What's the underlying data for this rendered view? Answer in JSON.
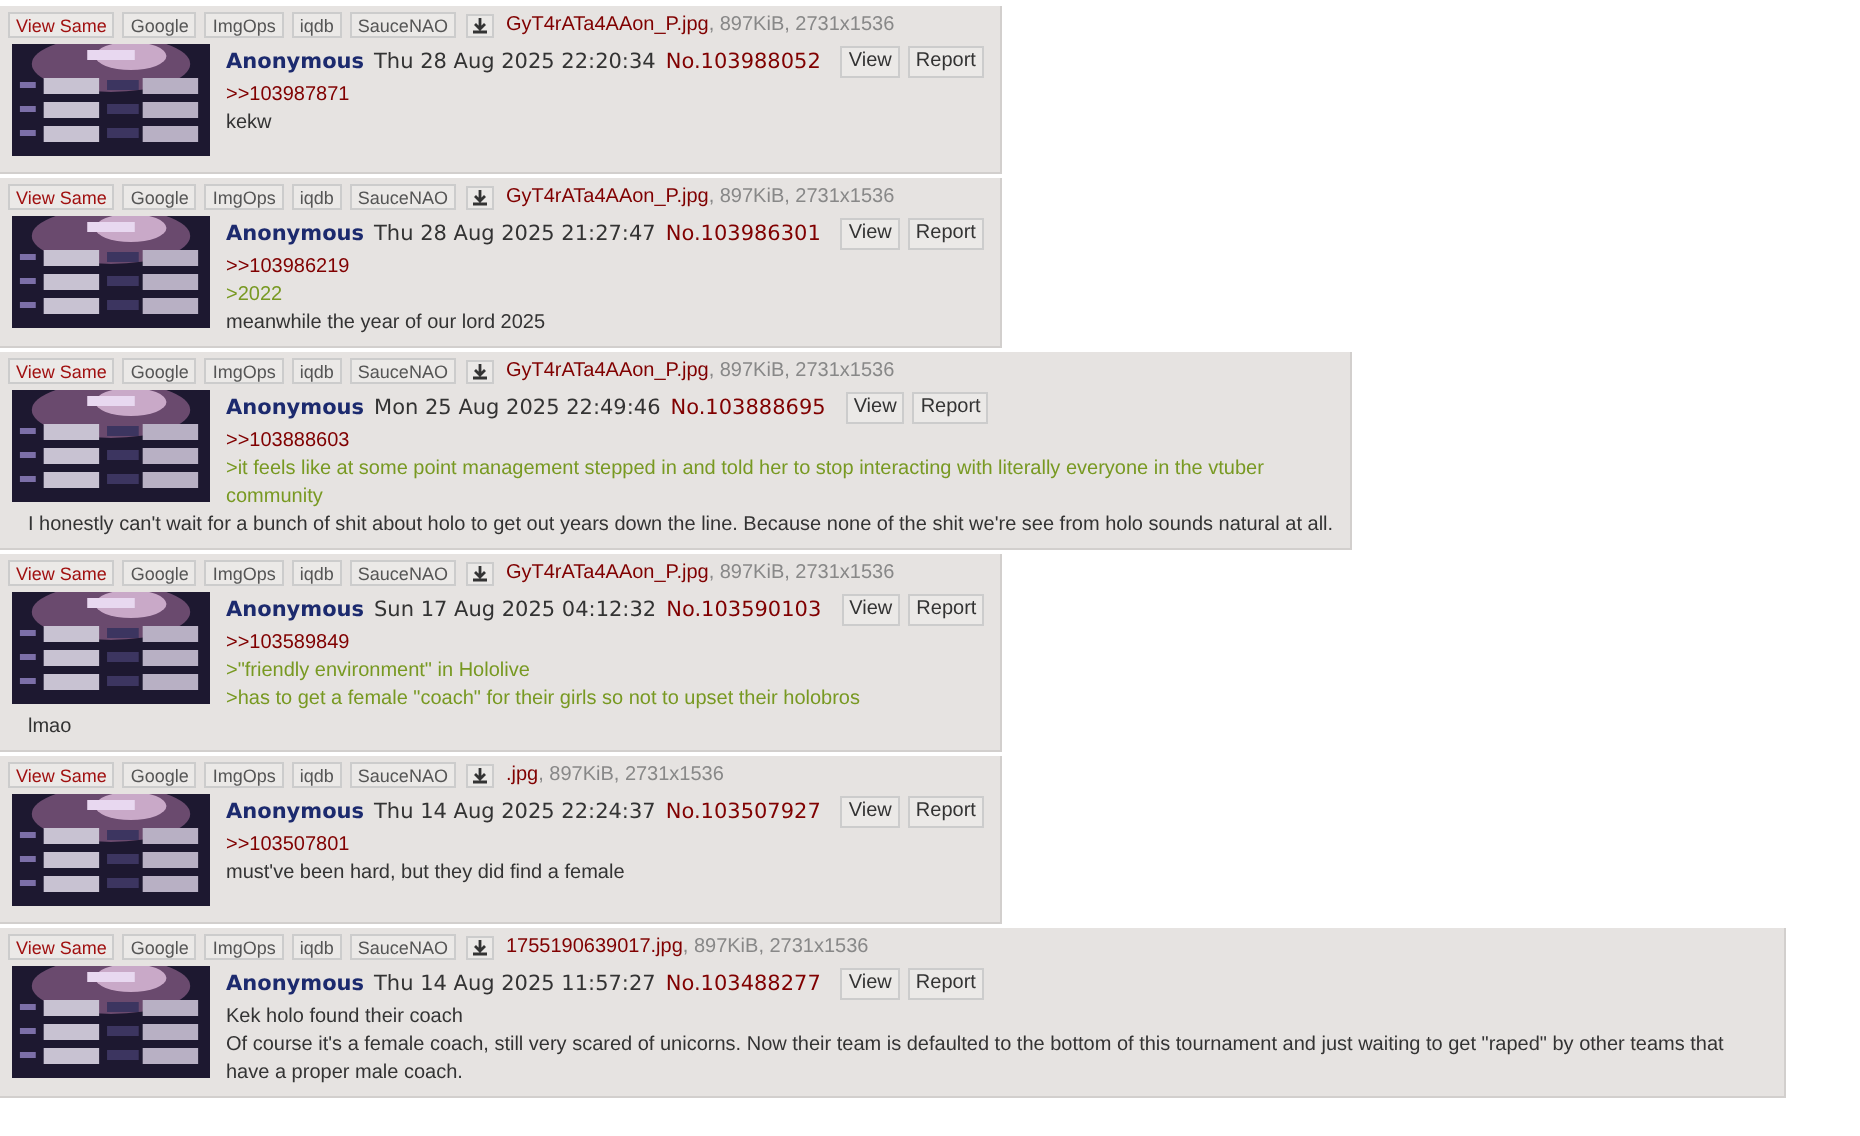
{
  "posts": [
    {
      "file": {
        "buttons": [
          "View Same",
          "Google",
          "ImgOps",
          "iqdb",
          "SauceNAO"
        ],
        "filename": "GyT4rATa4AAon_P.jpg",
        "meta": ", 897KiB, 2731x1536"
      },
      "name": "Anonymous",
      "date": "Thu 28 Aug 2025 22:20:34",
      "number": "No.103988052",
      "actions": [
        "View",
        "Report"
      ],
      "lines": [
        {
          "kind": "quote",
          "text": ">>103987871"
        },
        {
          "kind": "text",
          "text": "kekw"
        }
      ]
    },
    {
      "file": {
        "buttons": [
          "View Same",
          "Google",
          "ImgOps",
          "iqdb",
          "SauceNAO"
        ],
        "filename": "GyT4rATa4AAon_P.jpg",
        "meta": ", 897KiB, 2731x1536"
      },
      "name": "Anonymous",
      "date": "Thu 28 Aug 2025 21:27:47",
      "number": "No.103986301",
      "actions": [
        "View",
        "Report"
      ],
      "lines": [
        {
          "kind": "quote",
          "text": ">>103986219"
        },
        {
          "kind": "green",
          "text": ">2022"
        },
        {
          "kind": "text",
          "text": "meanwhile the year of our lord 2025"
        }
      ]
    },
    {
      "file": {
        "buttons": [
          "View Same",
          "Google",
          "ImgOps",
          "iqdb",
          "SauceNAO"
        ],
        "filename": "GyT4rATa4AAon_P.jpg",
        "meta": ", 897KiB, 2731x1536"
      },
      "name": "Anonymous",
      "date": "Mon 25 Aug 2025 22:49:46",
      "number": "No.103888695",
      "actions": [
        "View",
        "Report"
      ],
      "lines": [
        {
          "kind": "quote",
          "text": ">>103888603"
        },
        {
          "kind": "green",
          "text": ">it feels like at some point management stepped in and told her to stop interacting with literally everyone in the vtuber community"
        },
        {
          "kind": "text",
          "text": "I honestly can't wait for a bunch of shit about holo to get out years down the line. Because none of the shit we're see from holo sounds natural at all."
        }
      ]
    },
    {
      "file": {
        "buttons": [
          "View Same",
          "Google",
          "ImgOps",
          "iqdb",
          "SauceNAO"
        ],
        "filename": "GyT4rATa4AAon_P.jpg",
        "meta": ", 897KiB, 2731x1536"
      },
      "name": "Anonymous",
      "date": "Sun 17 Aug 2025 04:12:32",
      "number": "No.103590103",
      "actions": [
        "View",
        "Report"
      ],
      "lines": [
        {
          "kind": "quote",
          "text": ">>103589849"
        },
        {
          "kind": "green",
          "text": ">\"friendly environment\" in Hololive"
        },
        {
          "kind": "green",
          "text": ">has to get a female \"coach\" for their girls so not to upset their holobros"
        },
        {
          "kind": "text",
          "text": "lmao"
        }
      ]
    },
    {
      "file": {
        "buttons": [
          "View Same",
          "Google",
          "ImgOps",
          "iqdb",
          "SauceNAO"
        ],
        "filename": ".jpg",
        "meta": ", 897KiB, 2731x1536"
      },
      "name": "Anonymous",
      "date": "Thu 14 Aug 2025 22:24:37",
      "number": "No.103507927",
      "actions": [
        "View",
        "Report"
      ],
      "lines": [
        {
          "kind": "quote",
          "text": ">>103507801"
        },
        {
          "kind": "text",
          "text": "must've been hard, but they did find a female"
        }
      ]
    },
    {
      "file": {
        "buttons": [
          "View Same",
          "Google",
          "ImgOps",
          "iqdb",
          "SauceNAO"
        ],
        "filename": "1755190639017.jpg",
        "meta": ", 897KiB, 2731x1536"
      },
      "name": "Anonymous",
      "date": "Thu 14 Aug 2025 11:57:27",
      "number": "No.103488277",
      "actions": [
        "View",
        "Report"
      ],
      "lines": [
        {
          "kind": "text",
          "text": "Kek holo found their coach"
        },
        {
          "kind": "text",
          "text": "Of course it's a female coach, still very scared of unicorns. Now their team is defaulted to the bottom of this tournament and just waiting to get \"raped\" by other teams that have a proper male coach."
        }
      ]
    }
  ]
}
